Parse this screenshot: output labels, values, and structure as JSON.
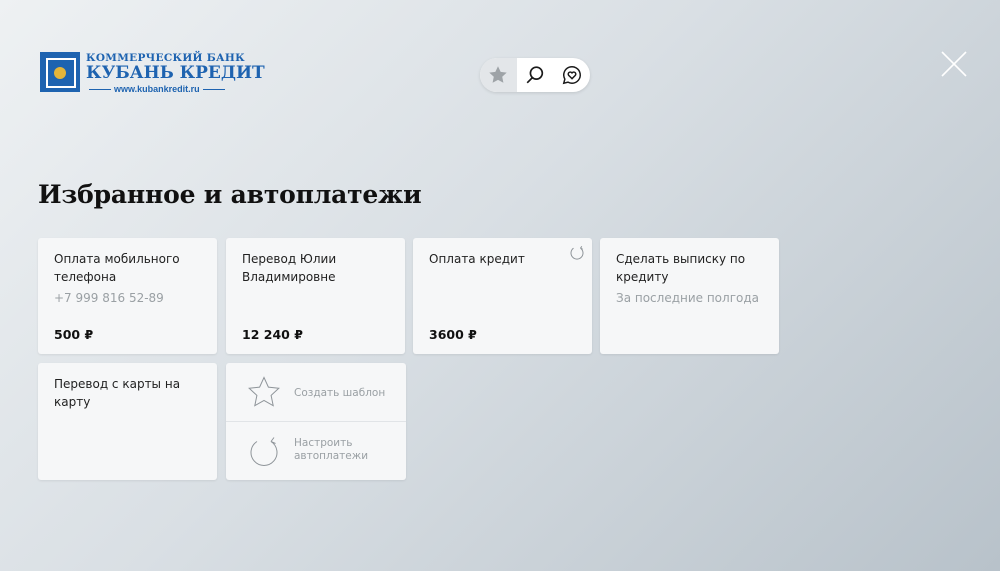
{
  "brand": {
    "line1": "КОММЕРЧЕСКИЙ БАНК",
    "line2": "КУБАНЬ КРЕДИТ",
    "site": "www.kubankredit.ru"
  },
  "topnav": {
    "items": [
      {
        "icon": "star-icon",
        "active": true
      },
      {
        "icon": "search-icon",
        "active": false
      },
      {
        "icon": "heart-chat-icon",
        "active": false
      }
    ]
  },
  "page": {
    "title": "Избранное и автоплатежи"
  },
  "cards": [
    {
      "name": "Оплата мобильного телефона",
      "sub": "+7 999 816 52-89",
      "amount": "500 ₽",
      "autopay": false
    },
    {
      "name": "Перевод Юлии Владимировне",
      "sub": "",
      "amount": "12 240 ₽",
      "autopay": false
    },
    {
      "name": "Оплата кредит",
      "sub": "",
      "amount": "3600 ₽",
      "autopay": true
    },
    {
      "name": "Сделать выписку по кредиту",
      "sub": "За последние полгода",
      "amount": "",
      "autopay": false
    },
    {
      "name": "Перевод с карты на карту",
      "sub": "",
      "amount": "",
      "autopay": false
    }
  ],
  "actions": {
    "create_template": "Создать шаблон",
    "setup_autopay_line1": "Настроить",
    "setup_autopay_line2": "автоплатежи"
  },
  "colors": {
    "brand_blue": "#1e63b0",
    "card_bg": "#f6f7f8",
    "muted_text": "#9aa0a4"
  }
}
